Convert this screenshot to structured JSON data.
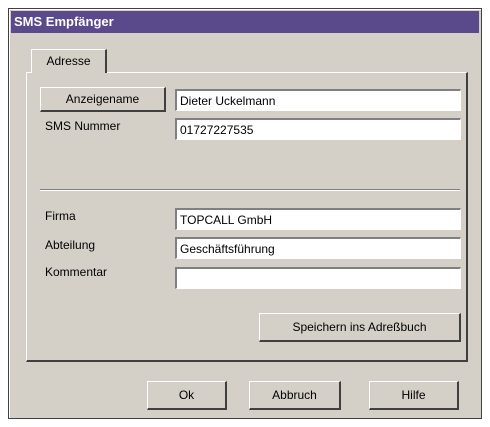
{
  "window": {
    "title": "SMS Empfänger"
  },
  "tabs": [
    {
      "label": "Adresse"
    }
  ],
  "form": {
    "display_name_button": "Anzeigename",
    "display_name_value": "Dieter Uckelmann",
    "sms_label": "SMS Nummer",
    "sms_value": "01727227535",
    "company_label": "Firma",
    "company_value": "TOPCALL GmbH",
    "department_label": "Abteilung",
    "department_value": "Geschäftsführung",
    "comment_label": "Kommentar",
    "comment_value": "",
    "save_button": "Speichern ins Adreßbuch"
  },
  "footer": {
    "ok_button": "Ok",
    "cancel_button": "Abbruch",
    "help_button": "Hilfe"
  },
  "colors": {
    "titlebar": "#5a4a8c",
    "face": "#d4d0c8"
  }
}
